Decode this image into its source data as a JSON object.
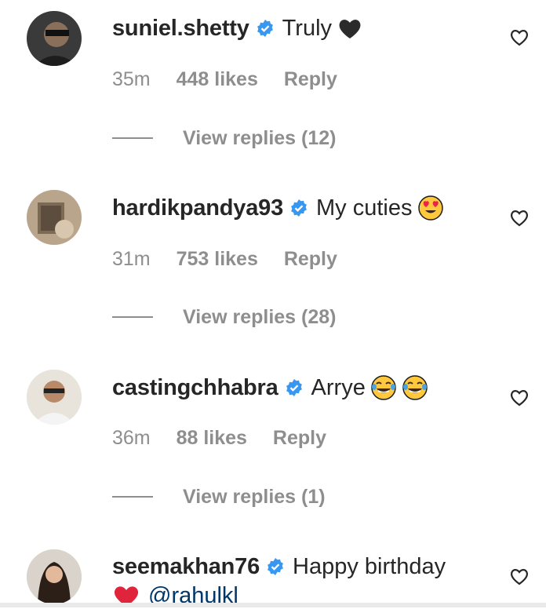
{
  "comments": [
    {
      "username": "suniel.shetty",
      "text": "Truly",
      "emoji": "black-heart",
      "time": "35m",
      "likes": "448 likes",
      "reply": "Reply",
      "view_replies": "View replies (12)"
    },
    {
      "username": "hardikpandya93",
      "text": "My cuties",
      "emoji": "heart-eyes",
      "time": "31m",
      "likes": "753 likes",
      "reply": "Reply",
      "view_replies": "View replies (28)"
    },
    {
      "username": "castingchhabra",
      "text": "Arrye",
      "emoji": "tears-of-joy-x2",
      "time": "36m",
      "likes": "88 likes",
      "reply": "Reply",
      "view_replies": "View replies (1)"
    },
    {
      "username": "seemakhan76",
      "text": "Happy birthday",
      "emoji": "red-heart",
      "mention": "@rahulkl"
    }
  ],
  "colors": {
    "text": "#262626",
    "muted": "#8e8e8e",
    "verified": "#3897f0",
    "mention": "#00376b",
    "heart": "#ed4956"
  },
  "icons": [
    "verified-badge-icon",
    "like-heart-outline-icon"
  ]
}
